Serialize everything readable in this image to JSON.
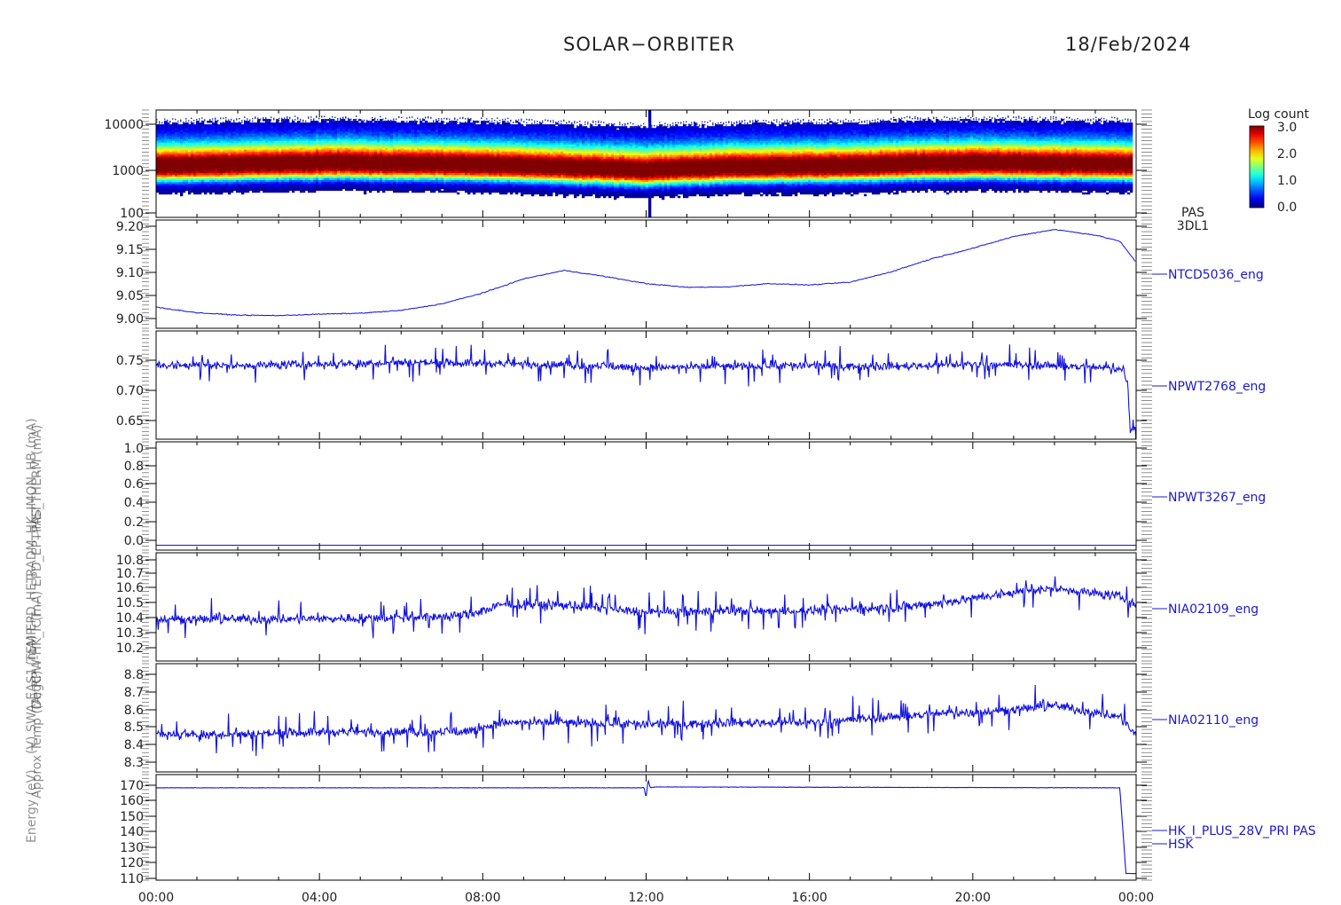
{
  "header": {
    "mission": "SOLAR−ORBITER",
    "date": "18/Feb/2024"
  },
  "time_axis": {
    "ticks": [
      "00:00",
      "04:00",
      "08:00",
      "12:00",
      "16:00",
      "20:00",
      "00:00"
    ],
    "range_hours": [
      0,
      24
    ]
  },
  "overlapping_y_labels": [
    "Energy (eV)",
    "Approx Temp (DegC)",
    "(V) SWA-EAS1_TEMP",
    "(A) RPW-HK_ICT",
    "(mA) EPD_HET",
    "(mA) EPD_EPT-HET",
    "RADM_HK_IMON_HB (mA)",
    "PAS_THERM (mA)"
  ],
  "colorbar": {
    "title": "Log count",
    "ticks": [
      "3.0",
      "2.0",
      "1.0",
      "0.0"
    ],
    "range": [
      0,
      3
    ]
  },
  "chart_data": [
    {
      "type": "heatmap",
      "right_label": [
        "PAS",
        "3DL1"
      ],
      "ylabel": "Energy (eV)",
      "y_log": true,
      "ylim": [
        100,
        15000
      ],
      "y_ticks": [
        "10000",
        "1000",
        "100"
      ],
      "peak_energy_eV": [
        [
          0,
          900
        ],
        [
          4.5,
          1050
        ],
        [
          8,
          950
        ],
        [
          12,
          750
        ],
        [
          14,
          860
        ],
        [
          16.5,
          900
        ],
        [
          20,
          1050
        ],
        [
          23.9,
          950
        ]
      ],
      "spike_at_hour": 12.05
    },
    {
      "type": "line",
      "right_label": "NTCD5036_eng",
      "ylabel": "Approx Temp (DegC)",
      "ylim": [
        8.98,
        9.21
      ],
      "y_ticks": [
        "9.20",
        "9.15",
        "9.10",
        "9.05",
        "9.00"
      ],
      "x": [
        0,
        1,
        2,
        3,
        4,
        5,
        6,
        7,
        8,
        9,
        10,
        11,
        12,
        13,
        14,
        15,
        16,
        17,
        18,
        19,
        20,
        21,
        22,
        23,
        23.6,
        24
      ],
      "values": [
        9.025,
        9.013,
        9.008,
        9.007,
        9.01,
        9.012,
        9.018,
        9.032,
        9.055,
        9.085,
        9.103,
        9.09,
        9.075,
        9.067,
        9.068,
        9.075,
        9.072,
        9.078,
        9.1,
        9.128,
        9.15,
        9.175,
        9.19,
        9.178,
        9.165,
        9.12
      ]
    },
    {
      "type": "line",
      "right_label": "NPWT2768_eng",
      "ylim": [
        0.625,
        0.775
      ],
      "y_ticks": [
        "0.75",
        "0.70",
        "0.65"
      ],
      "x": [
        0,
        2,
        4,
        6,
        8,
        10,
        12,
        14,
        16,
        18,
        20,
        22,
        23.7,
        23.8,
        23.85,
        24
      ],
      "values": [
        0.728,
        0.727,
        0.729,
        0.732,
        0.73,
        0.728,
        0.724,
        0.726,
        0.727,
        0.726,
        0.729,
        0.727,
        0.722,
        0.7,
        0.64,
        0.64
      ]
    },
    {
      "type": "line",
      "right_label": "NPWT3267_eng",
      "ylim": [
        -0.05,
        1.05
      ],
      "y_ticks": [
        "1.0",
        "0.8",
        "0.6",
        "0.4",
        "0.2",
        "0.0"
      ],
      "x": [
        0,
        24
      ],
      "values": [
        0.0,
        0.0
      ]
    },
    {
      "type": "line",
      "right_label": "NIA02109_eng",
      "ylim": [
        10.15,
        10.82
      ],
      "y_ticks": [
        "10.8",
        "10.7",
        "10.6",
        "10.5",
        "10.4",
        "10.3",
        "10.2"
      ],
      "x": [
        0,
        2,
        4,
        6,
        7.5,
        8.5,
        10,
        12,
        14,
        16,
        18,
        19.5,
        20.5,
        22,
        23.6,
        24
      ],
      "values": [
        10.41,
        10.41,
        10.41,
        10.42,
        10.43,
        10.5,
        10.5,
        10.45,
        10.46,
        10.46,
        10.48,
        10.52,
        10.56,
        10.6,
        10.55,
        10.5
      ]
    },
    {
      "type": "line",
      "right_label": "NIA02110_eng",
      "ylim": [
        8.26,
        8.83
      ],
      "y_ticks": [
        "8.8",
        "8.7",
        "8.6",
        "8.5",
        "8.4",
        "8.3"
      ],
      "x": [
        0,
        2,
        4,
        6,
        7.5,
        8.5,
        10,
        12,
        14,
        16,
        18,
        19.5,
        20.5,
        22,
        23.6,
        24
      ],
      "values": [
        8.46,
        8.46,
        8.47,
        8.47,
        8.47,
        8.52,
        8.52,
        8.51,
        8.52,
        8.52,
        8.55,
        8.57,
        8.58,
        8.61,
        8.55,
        8.45
      ]
    },
    {
      "type": "line",
      "right_label": [
        "HK_I_PLUS_28V_PRI PAS",
        "HSK"
      ],
      "ylim": [
        108,
        172
      ],
      "y_ticks": [
        "170",
        "160",
        "150",
        "140",
        "130",
        "120",
        "110"
      ],
      "x": [
        0,
        11.95,
        12.0,
        12.05,
        12.1,
        12.2,
        23.6,
        23.7,
        23.75,
        24
      ],
      "values": [
        164,
        164,
        158,
        169,
        164,
        164.5,
        164,
        130,
        112,
        112
      ]
    }
  ]
}
